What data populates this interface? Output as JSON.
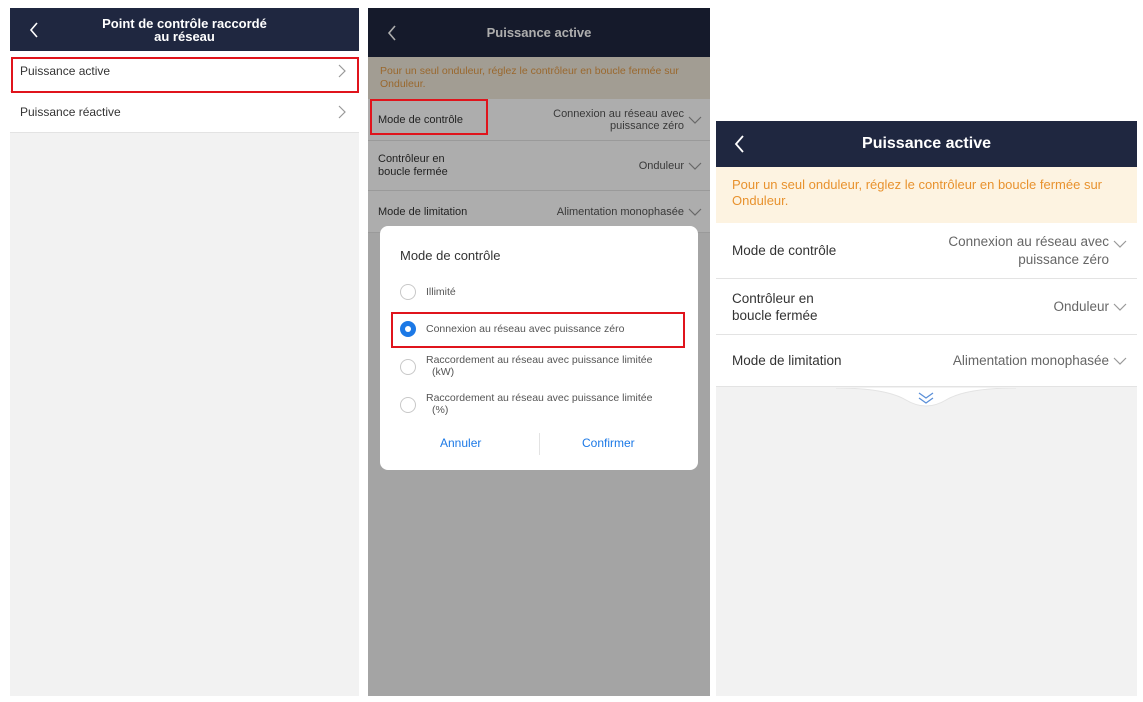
{
  "screen1": {
    "title_line1": "Point de contrôle raccordé",
    "title_line2": "au réseau",
    "items": [
      {
        "label": "Puissance active"
      },
      {
        "label": "Puissance réactive"
      }
    ]
  },
  "screen2": {
    "title": "Puissance active",
    "notice": "Pour un seul onduleur, réglez le contrôleur en boucle fermée sur Onduleur.",
    "rows": [
      {
        "label": "Mode de contrôle",
        "value_line1": "Connexion au réseau avec",
        "value_line2": "puissance zéro"
      },
      {
        "label_line1": "Contrôleur en",
        "label_line2": "boucle fermée",
        "value": "Onduleur"
      },
      {
        "label": "Mode de limitation",
        "value": "Alimentation monophasée"
      }
    ],
    "dialog": {
      "title": "Mode de contrôle",
      "options": [
        {
          "label": "Illimité"
        },
        {
          "label": "Connexion au réseau avec puissance zéro"
        },
        {
          "label_line1": "Raccordement au réseau avec puissance limitée",
          "label_line2": "(kW)"
        },
        {
          "label_line1": "Raccordement au réseau avec puissance limitée",
          "label_line2": "(%)"
        }
      ],
      "selected_index": 1,
      "cancel": "Annuler",
      "confirm": "Confirmer"
    }
  },
  "screen3": {
    "title": "Puissance active",
    "notice": "Pour un seul onduleur, réglez le contrôleur en boucle fermée sur Onduleur.",
    "rows": [
      {
        "label": "Mode de contrôle",
        "value_line1": "Connexion au réseau avec",
        "value_line2": "puissance zéro"
      },
      {
        "label_line1": "Contrôleur en",
        "label_line2": "boucle fermée",
        "value": "Onduleur"
      },
      {
        "label": "Mode de limitation",
        "value": "Alimentation monophasée"
      }
    ]
  },
  "colors": {
    "nav_bar": "#1f2740",
    "highlight_box": "#e0141c",
    "notice_text": "#e8922e",
    "radio_selected": "#1c79e6",
    "dialog_buttons": "#1c79e6"
  },
  "icons": {
    "back": "chevron-left-icon",
    "row_arrow": "chevron-right-icon",
    "dropdown": "chevron-down-icon",
    "expand": "double-chevron-down-icon"
  }
}
